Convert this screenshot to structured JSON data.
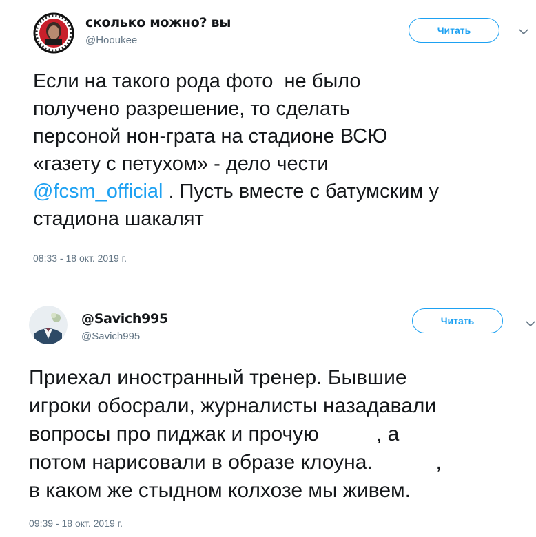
{
  "tweets": [
    {
      "display_name": "сколько можно? вы",
      "handle": "@Hooukee",
      "follow_label": "Читать",
      "text_before": "Если на такого рода фото  не было\nполучено разрешение, то сделать\nперсоной нон-грата на стадионе ВСЮ\n«газету с петухом» - дело чести\n",
      "mention": "@fcsm_official",
      "text_after": " . Пусть вместе с батумским у\nстадиона шакалят",
      "timestamp": "08:33 - 18 окт. 2019 г."
    },
    {
      "display_name": "@Savich995",
      "handle": "@Savich995",
      "follow_label": "Читать",
      "text": "Приехал иностранный тренер. Бывшие\nигроки обосрали, журналисты назадавали\nвопросы про пиджак и прочую          , а\nпотом нарисовали в образе клоуна.           ,\nв каком же стыдном колхозе мы живем.",
      "timestamp": "09:39 - 18 окт. 2019 г."
    }
  ],
  "icons": {
    "chevron": "chevron-down-icon"
  },
  "colors": {
    "accent": "#1da1f2",
    "text": "#14171a",
    "muted": "#657786"
  }
}
